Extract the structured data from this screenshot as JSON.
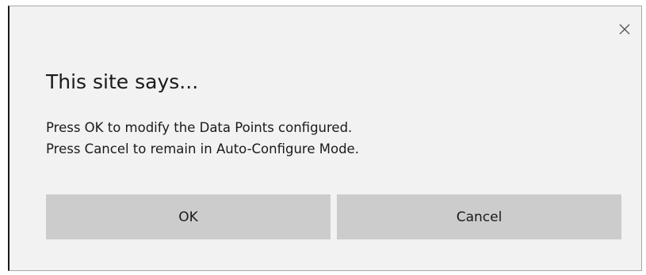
{
  "dialog": {
    "title": "This site says...",
    "message_lines": [
      "Press OK to modify the Data Points configured.",
      "Press Cancel to remain in Auto-Configure Mode."
    ],
    "close_icon": "close-icon",
    "buttons": {
      "ok_label": "OK",
      "cancel_label": "Cancel"
    }
  },
  "colors": {
    "dialog_background": "#f2f2f2",
    "button_background": "#cccccc",
    "text": "#1a1a1a"
  }
}
